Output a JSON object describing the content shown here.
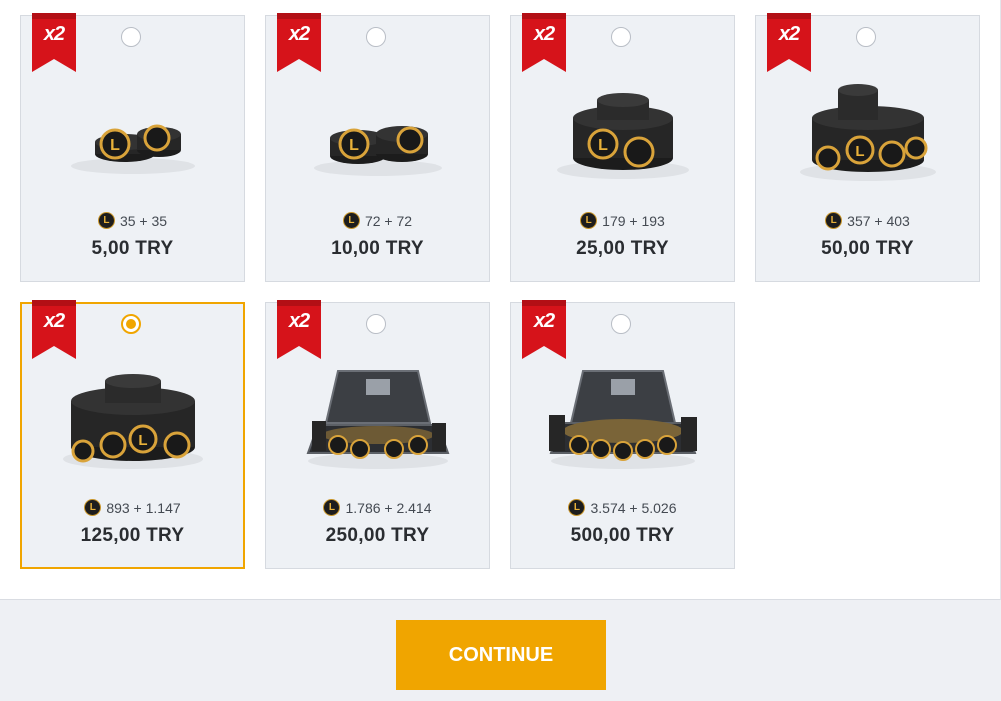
{
  "badge_label": "x2",
  "packages": [
    {
      "coins": "35 + 35",
      "price": "5,00 TRY",
      "selected": false,
      "art": "coin-pile-small-icon"
    },
    {
      "coins": "72 + 72",
      "price": "10,00 TRY",
      "selected": false,
      "art": "coin-pile-small-icon"
    },
    {
      "coins": "179 + 193",
      "price": "25,00 TRY",
      "selected": false,
      "art": "coin-stack-icon"
    },
    {
      "coins": "357 + 403",
      "price": "50,00 TRY",
      "selected": false,
      "art": "coin-stack-large-icon"
    },
    {
      "coins": "893 + 1.147",
      "price": "125,00 TRY",
      "selected": true,
      "art": "coin-pile-large-icon"
    },
    {
      "coins": "1.786 + 2.414",
      "price": "250,00 TRY",
      "selected": false,
      "art": "coin-briefcase-icon"
    },
    {
      "coins": "3.574 + 5.026",
      "price": "500,00 TRY",
      "selected": false,
      "art": "coin-briefcase-full-icon"
    }
  ],
  "continue_label": "CONTINUE",
  "colors": {
    "accent": "#f0a500",
    "ribbon_red": "#d6131a",
    "card_bg": "#eef1f5"
  }
}
